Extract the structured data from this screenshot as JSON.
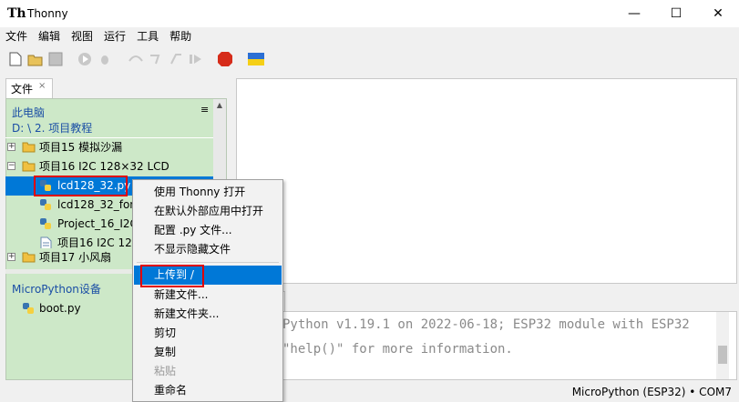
{
  "window": {
    "title": "Thonny",
    "minimize_glyph": "—",
    "maximize_glyph": "☐",
    "close_glyph": "✕"
  },
  "menubar": [
    "文件",
    "编辑",
    "视图",
    "运行",
    "工具",
    "帮助"
  ],
  "toolbar": {
    "icons": [
      "new-file-icon",
      "open-file-icon",
      "save-icon",
      "run-icon",
      "debug-icon",
      "step-over-icon",
      "step-into-icon",
      "step-out-icon",
      "resume-icon",
      "stop-icon",
      "ukraine-flag-icon"
    ],
    "stop_label": "STOP"
  },
  "files_panel": {
    "tab_label": "文件",
    "tab_close": "×",
    "menu_icon": "≡",
    "computer_label": "此电脑",
    "path": "D: \\ 2. 项目教程",
    "tree": [
      {
        "label": "项目15 模拟沙漏",
        "type": "folder",
        "expander": "+"
      },
      {
        "label": "项目16 I2C 128×32 LCD",
        "type": "folder",
        "expander": "−"
      },
      {
        "label": "lcd128_32.py",
        "type": "python",
        "selected": true
      },
      {
        "label": "lcd128_32_font",
        "type": "python"
      },
      {
        "label": "Project_16_I2C",
        "type": "python"
      },
      {
        "label": "项目16 I2C 128",
        "type": "text"
      },
      {
        "label": "项目17 小风扇",
        "type": "folder",
        "expander": "+"
      }
    ],
    "device_label": "MicroPython设备",
    "device_files": [
      {
        "label": "boot.py",
        "type": "python"
      }
    ]
  },
  "shell": {
    "lines": [
      "Python v1.19.1 on 2022-06-18; ESP32 module with ESP32",
      "\"help()\" for more information."
    ]
  },
  "statusbar": {
    "text": "MicroPython (ESP32)  •  COM7"
  },
  "context_menu": {
    "items": [
      {
        "label": "使用 Thonny 打开",
        "enabled": true
      },
      {
        "label": "在默认外部应用中打开",
        "enabled": true
      },
      {
        "label": "配置 .py 文件...",
        "enabled": true
      },
      {
        "label": "不显示隐藏文件",
        "enabled": true
      },
      {
        "label": "上传到 /",
        "enabled": true,
        "highlighted": true
      },
      {
        "label": "新建文件...",
        "enabled": true
      },
      {
        "label": "新建文件夹...",
        "enabled": true
      },
      {
        "label": "剪切",
        "enabled": true
      },
      {
        "label": "复制",
        "enabled": true
      },
      {
        "label": "粘贴",
        "enabled": false
      },
      {
        "label": "重命名",
        "enabled": true
      }
    ]
  },
  "colors": {
    "selection": "#0078d7",
    "panel_bg": "#cde8c8",
    "highlight_box": "#e00000",
    "link_blue": "#1a4ea5"
  }
}
